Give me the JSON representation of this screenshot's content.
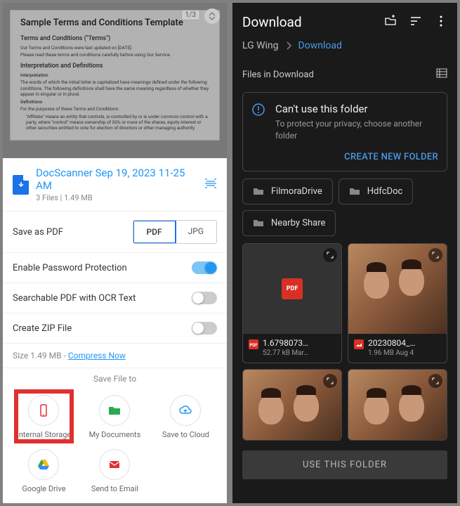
{
  "left": {
    "doc": {
      "title": "Sample Terms and Conditions Template",
      "page_indicator": "1/3",
      "heading": "Terms and Conditions (\"Terms\")",
      "line1": "Our Terms and Conditions were last updated on [DATE].",
      "line2": "Please read these terms and conditions carefully before using Our Service.",
      "section1": "Interpretation and Definitions",
      "sub1": "Interpretation",
      "para1": "The words of which the initial letter is capitalized have meanings defined under the following conditions. The following definitions shall have the same meaning regardless of whether they appear in singular or in plural.",
      "sub2": "Definitions",
      "para2": "For the purposes of these Terms and Conditions:",
      "bullet": "\"Affiliate\" means an entity that controls, is controlled by or is under common control with a party, where \"control\" means ownership of 50% or more of the shares, equity interest or other securities entitled to vote for election of directors or other managing authority."
    },
    "file": {
      "name": "DocScanner Sep 19, 2023 11-25 AM",
      "sub": "3 Files  |  1.49 MB"
    },
    "save_as": "Save as PDF",
    "format_pdf": "PDF",
    "format_jpg": "JPG",
    "password": "Enable Password Protection",
    "ocr": "Searchable PDF with OCR Text",
    "zip": "Create ZIP File",
    "size_prefix": "Size 1.49 MB - ",
    "compress": "Compress Now",
    "save_to": "Save File to",
    "dest": {
      "internal": "Internal Storage",
      "mydocs": "My Documents",
      "cloud": "Save to Cloud",
      "gdrive": "Google Drive",
      "email": "Send to Email"
    }
  },
  "right": {
    "title": "Download",
    "crumb_root": "LG Wing",
    "crumb_cur": "Download",
    "files_in": "Files in Download",
    "banner": {
      "title": "Can't use this folder",
      "sub": "To protect your privacy, choose another folder",
      "cta": "CREATE NEW FOLDER"
    },
    "chips": [
      "FilmoraDrive",
      "HdfcDoc",
      "Nearby Share"
    ],
    "files": [
      {
        "name": "1.6798073…",
        "meta": "52.77 kB Mar…",
        "type": "pdf"
      },
      {
        "name": "20230804_…",
        "meta": "1.96 MB Aug 4",
        "type": "img"
      }
    ],
    "use_folder": "USE THIS FOLDER"
  }
}
